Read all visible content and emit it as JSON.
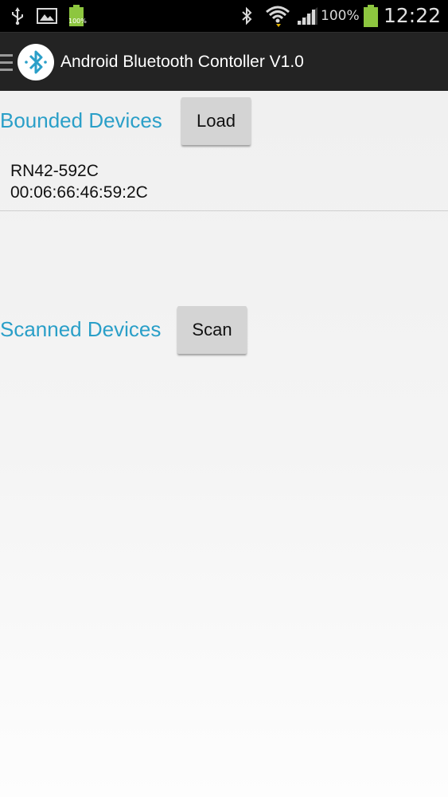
{
  "status_bar": {
    "icons": [
      "usb-icon",
      "image-icon",
      "battery-charged-icon",
      "bluetooth-icon",
      "wifi-icon",
      "signal-icon",
      "battery-icon"
    ],
    "battery_badge": "100%",
    "battery_percent": "100%",
    "time": "12:22"
  },
  "action_bar": {
    "title": "Android Bluetooth Contoller V1.0",
    "logo_icon": "bluetooth-logo-icon",
    "menu_icon": "menu-icon"
  },
  "bounded": {
    "label": "Bounded Devices",
    "button_label": "Load",
    "devices": [
      {
        "name": "RN42-592C",
        "address": "00:06:66:46:59:2C"
      }
    ]
  },
  "scanned": {
    "label": "Scanned Devices",
    "button_label": "Scan"
  },
  "colors": {
    "accent": "#2a9fc8",
    "action_bar": "#232323",
    "status_bar": "#000000",
    "button": "#d4d4d4"
  }
}
